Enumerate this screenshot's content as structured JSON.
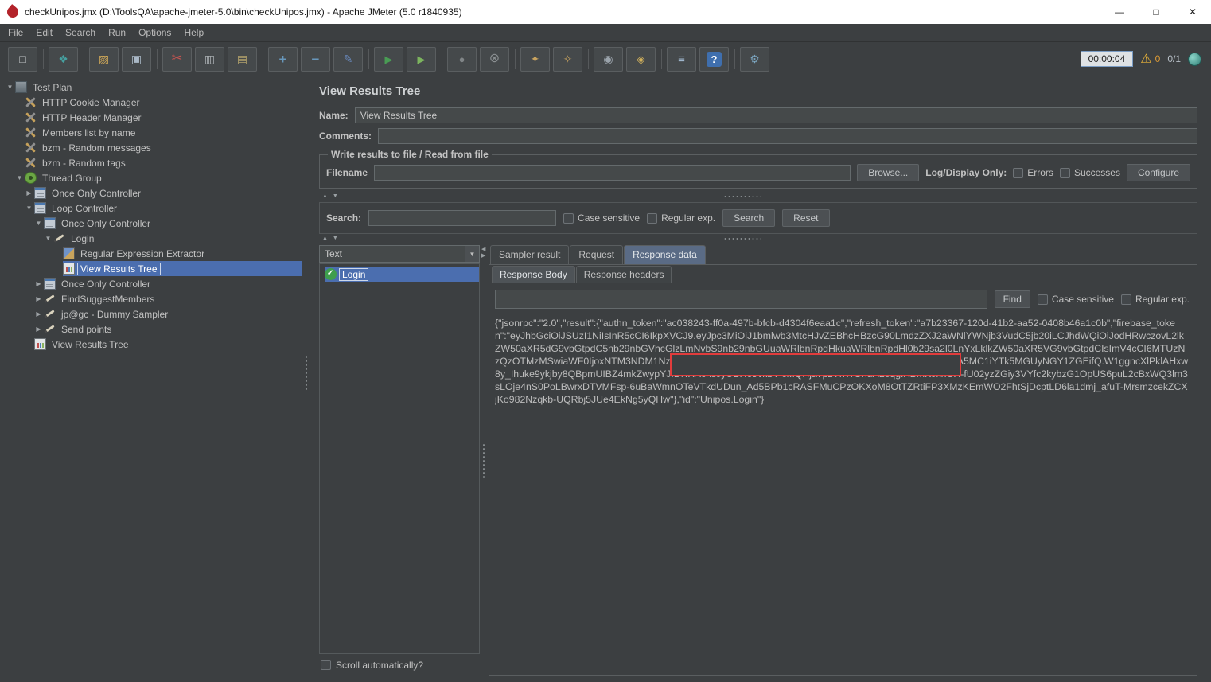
{
  "window": {
    "title": "checkUnipos.jmx (D:\\ToolsQA\\apache-jmeter-5.0\\bin\\checkUnipos.jmx) - Apache JMeter (5.0 r1840935)",
    "minimize": "—",
    "maximize": "□",
    "close": "✕"
  },
  "menubar": {
    "items": [
      "File",
      "Edit",
      "Search",
      "Run",
      "Options",
      "Help"
    ]
  },
  "toolbar": {
    "icons": [
      {
        "name": "new-file",
        "glyph": "□"
      },
      {
        "name": "templates",
        "glyph": "❖"
      },
      {
        "name": "open-file",
        "glyph": "▨"
      },
      {
        "name": "save-file",
        "glyph": "▣"
      },
      {
        "name": "cut",
        "glyph": "✂"
      },
      {
        "name": "copy",
        "glyph": "▥"
      },
      {
        "name": "paste",
        "glyph": "▤"
      },
      {
        "name": "expand-all",
        "glyph": "+"
      },
      {
        "name": "collapse-all",
        "glyph": "−"
      },
      {
        "name": "toggle-elements",
        "glyph": "✎"
      },
      {
        "name": "start",
        "glyph": "▶"
      },
      {
        "name": "start-no-pauses",
        "glyph": "▶"
      },
      {
        "name": "stop",
        "glyph": "●"
      },
      {
        "name": "shutdown",
        "glyph": "⊗"
      },
      {
        "name": "clear",
        "glyph": "✦"
      },
      {
        "name": "clear-all",
        "glyph": "✧"
      },
      {
        "name": "search",
        "glyph": "◉"
      },
      {
        "name": "search-reset",
        "glyph": "◈"
      },
      {
        "name": "function-helper",
        "glyph": "≡"
      },
      {
        "name": "help",
        "glyph": "?"
      },
      {
        "name": "ssl-manager",
        "glyph": "⚙"
      }
    ],
    "timer": "00:00:04",
    "warning_glyph": "⚠",
    "warning_count": "0",
    "thread_counter": "0/1"
  },
  "glyphs": {
    "tree_expanded": "▼",
    "tree_collapsed": "▶",
    "dropdown": "▼",
    "split_updown": "▲ ▼",
    "split_left": "◀",
    "split_right": "▶"
  },
  "colors": {
    "selection_blue": "#4b6eaf",
    "panel_background": "#3c3f41",
    "warning_yellow": "#e8b339",
    "redaction_red": "#e23c3c",
    "success_green": "#3f9e4d"
  },
  "tree": {
    "items": [
      {
        "label": "Test Plan"
      },
      {
        "label": "HTTP Cookie Manager"
      },
      {
        "label": "HTTP Header Manager"
      },
      {
        "label": "Members list by name"
      },
      {
        "label": "bzm - Random messages"
      },
      {
        "label": "bzm - Random tags"
      },
      {
        "label": "Thread Group"
      },
      {
        "label": "Once Only Controller"
      },
      {
        "label": "Loop Controller"
      },
      {
        "label": "Once Only Controller"
      },
      {
        "label": "Login"
      },
      {
        "label": "Regular Expression Extractor"
      },
      {
        "label": "View Results Tree"
      },
      {
        "label": "Once Only Controller"
      },
      {
        "label": "FindSuggestMembers"
      },
      {
        "label": "jp@gc - Dummy Sampler"
      },
      {
        "label": "Send points"
      },
      {
        "label": "View Results Tree"
      }
    ]
  },
  "main": {
    "title": "View Results Tree",
    "name_label": "Name:",
    "name_value": "View Results Tree",
    "comments_label": "Comments:",
    "file_group": {
      "legend": "Write results to file / Read from file",
      "filename_label": "Filename",
      "browse_button": "Browse...",
      "log_display_label": "Log/Display Only:",
      "errors_label": "Errors",
      "successes_label": "Successes",
      "configure_button": "Configure"
    },
    "search": {
      "label": "Search:",
      "case_sensitive_label": "Case sensitive",
      "regular_exp_label": "Regular exp.",
      "search_button": "Search",
      "reset_button": "Reset"
    },
    "results": {
      "view_mode": "Text",
      "items": [
        {
          "label": "Login"
        }
      ],
      "scroll_label": "Scroll automatically?"
    },
    "tabs": [
      {
        "label": "Sampler result"
      },
      {
        "label": "Request"
      },
      {
        "label": "Response data"
      }
    ],
    "response_tabs": [
      {
        "label": "Response Body"
      },
      {
        "label": "Response headers"
      }
    ],
    "find": {
      "find_button": "Find",
      "case_sensitive_label": "Case sensitive",
      "regular_exp_label": "Regular exp."
    },
    "response_body": {
      "segment1": "{\"jsonrpc\":\"2.0\",\"result\":{\"authn_token\":\"ac038243-ff0a-497b-bfcb-d4304f6eaa1c\",\"refresh_token\":\"a7b23367-120d-41b2-aa52-0408b46a1c0b\",\"firebase_token\":\"eyJhbGciOiJSUzI1NiIsInR5cCI6IkpXVCJ9.eyJpc3MiOiJ1bmlwb3MtcHJvZEBhcHBzcG90LmdzZXJ2aWNlYWNjb3VudC5jb20iLCJhdWQiOiJodHRwczovL2lkZW50aXR5dG9vbGtpdC5nb29nbGVhcGlzLmNvbS9nb29nbGUuaWRlbnRpdHkuaWRlbnRpdHl0b29sa2l0LnYxLklkZW50aXR5VG9vbGtpdCIsImV4cCI6MTUzNzQzOTMzMSwiaWF0IjoxNTM3NDM1NzMxLCJzdWI",
      "segment2": "b20iLCJ1aWQiOiI4MDRiZDY3Yi0yYmM2LTRjM2ItODA5MC1iYTk5MGUyNGY1ZGEifQ.W1ggn",
      "segment3": "cXlPklAHxw8y_Ihuke9ykjby8QBpmUIBZ4mkZwypYJIDNXAchsJyUBH69vkbY-cMQHja7pzYhWOhdALoqgIXBmKJknCH-fU02yzZGiy3VYfc2kybzG1OpUS6puL2cBxWQ3lm3sLOje4nS0PoLBwrxDTVMFsp-6uBaWmnOTeVTkdUDun_Ad5BPb1cRASFMuCPzOKXoM8OtTZRtiFP3XMzKEmWO2FhtSjDcptLD6la1dmj_afuT-MrsmzcekZCXjKo982Nzqkb-UQRbj5JUe4EkNg5yQHw\"},\"id\":\"Unipos.Login\"}"
    }
  }
}
